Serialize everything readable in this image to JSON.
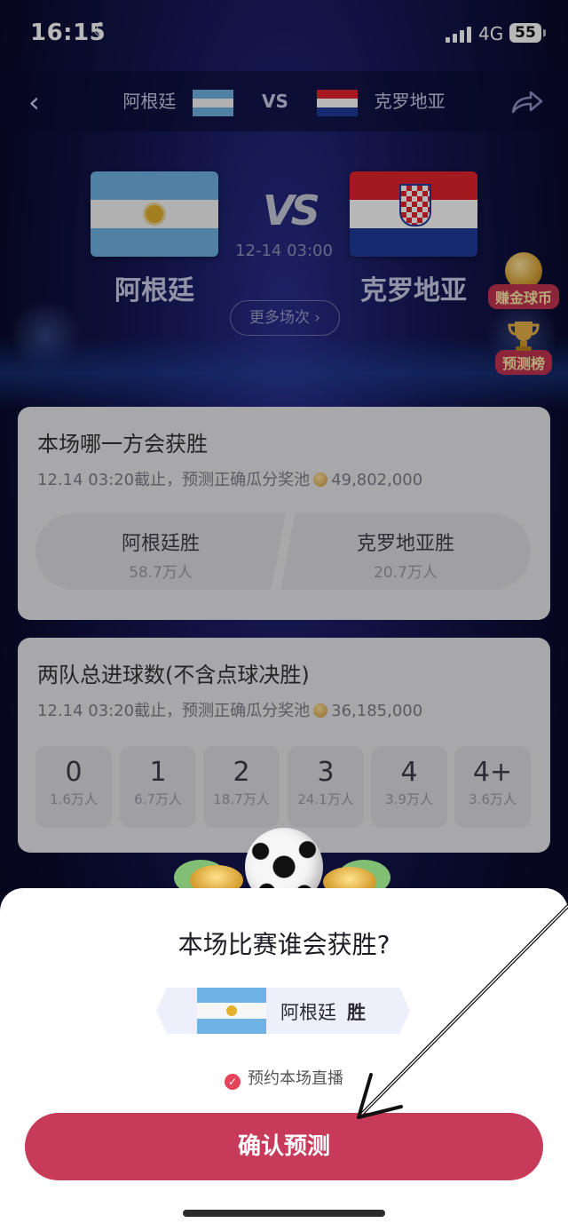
{
  "status_bar": {
    "time": "16:15",
    "network": "4G",
    "battery": "55"
  },
  "header": {
    "team_left": "阿根廷",
    "vs": "VS",
    "team_right": "克罗地亚"
  },
  "match": {
    "vs": "VS",
    "time": "12-14 03:00",
    "team_left": "阿根廷",
    "team_right": "克罗地亚",
    "more_button": "更多场次 ›"
  },
  "side": {
    "coins_label": "赚金球币",
    "rank_label": "预测榜"
  },
  "card1": {
    "title": "本场哪一方会获胜",
    "deadline": "12.14 03:20截止，预测正确瓜分奖池",
    "pool": "49,802,000",
    "options": [
      {
        "name": "阿根廷胜",
        "count": "58.7万人"
      },
      {
        "name": "克罗地亚胜",
        "count": "20.7万人"
      }
    ]
  },
  "card2": {
    "title": "两队总进球数(不含点球决胜)",
    "deadline": "12.14 03:20截止，预测正确瓜分奖池",
    "pool": "36,185,000",
    "options": [
      {
        "label": "0",
        "count": "1.6万人"
      },
      {
        "label": "1",
        "count": "6.7万人"
      },
      {
        "label": "2",
        "count": "18.7万人"
      },
      {
        "label": "3",
        "count": "24.1万人"
      },
      {
        "label": "4",
        "count": "3.9万人"
      },
      {
        "label": "4+",
        "count": "3.6万人"
      }
    ]
  },
  "modal": {
    "title": "本场比赛谁会获胜?",
    "pick_team": "阿根廷",
    "pick_result": "胜",
    "reserve_text": "预约本场直播",
    "confirm_button": "确认预测"
  },
  "colors": {
    "accent": "#c83a5a",
    "argentina_blue": "#6fb2e4",
    "croatia_red": "#e4232c",
    "croatia_blue": "#1f3b9a"
  }
}
